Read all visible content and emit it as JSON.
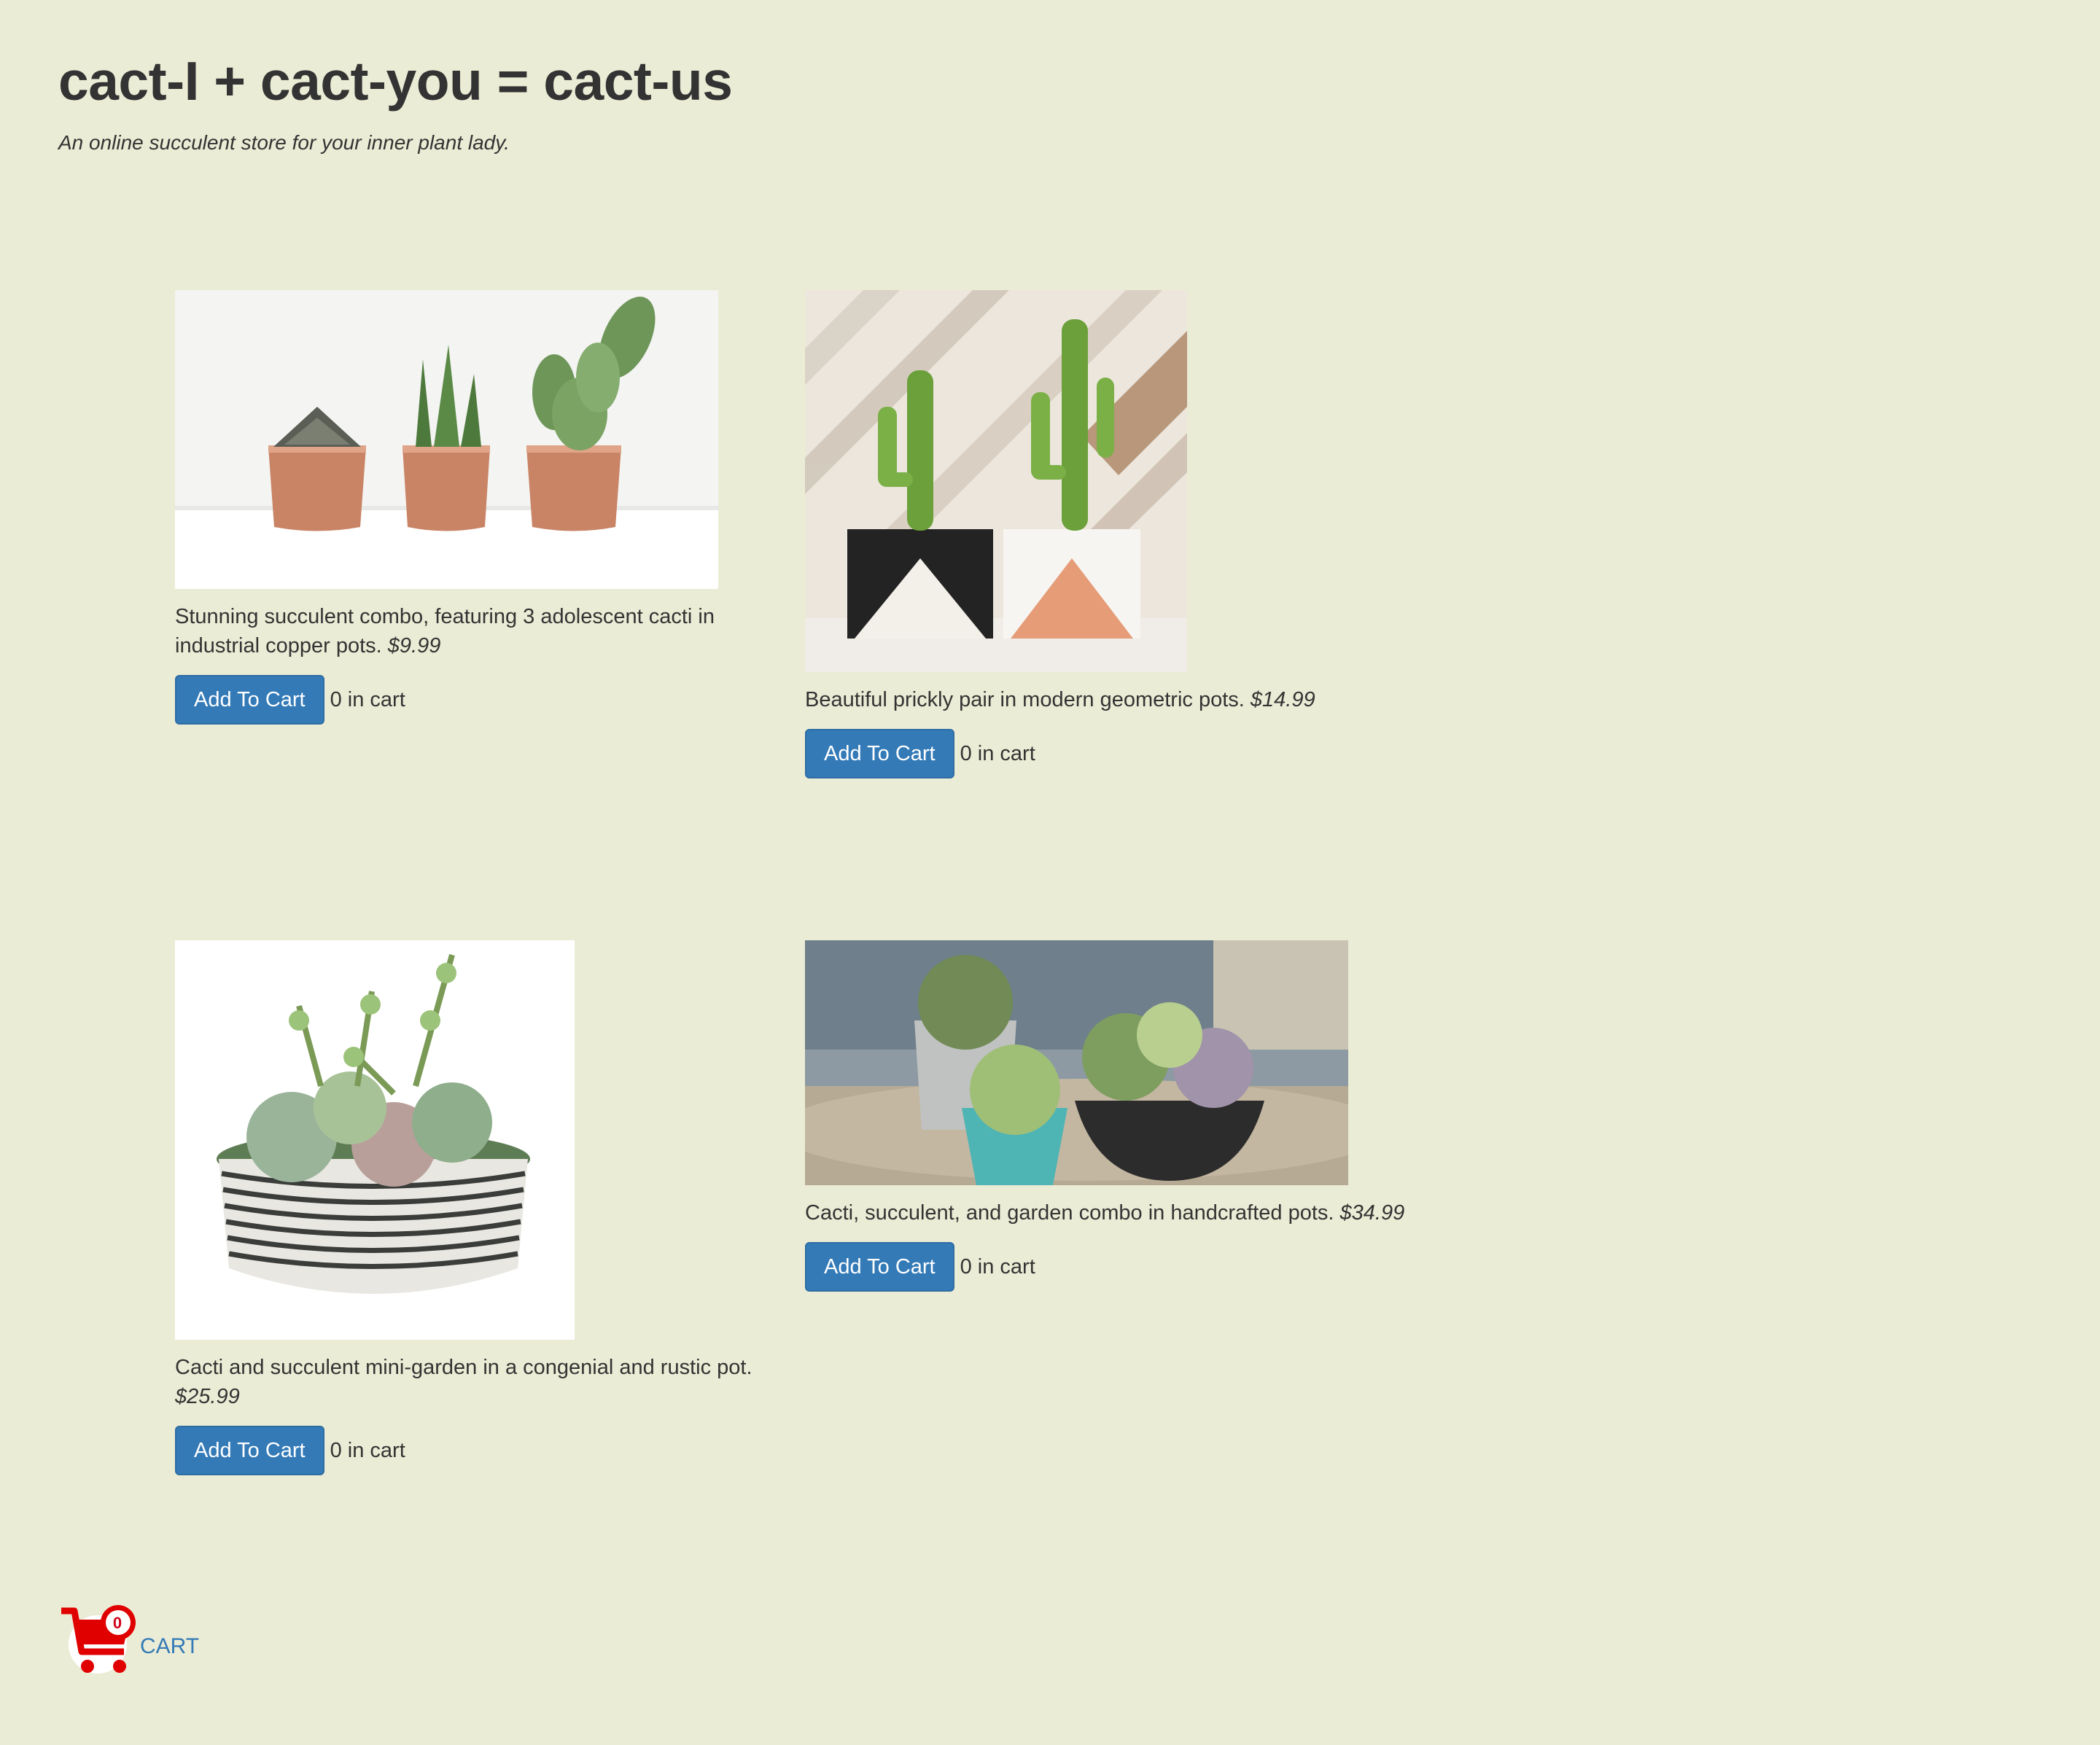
{
  "header": {
    "title": "cact-I + cact-you = cact-us",
    "tagline": "An online succulent store for your inner plant lady."
  },
  "products": [
    {
      "description": "Stunning succulent combo, featuring 3 adolescent cacti in industrial copper pots.",
      "price": "$9.99",
      "button_label": "Add To Cart",
      "cart_status": "0 in cart",
      "image_icon": "three-cacti-copper-pots-photo"
    },
    {
      "description": "Beautiful prickly pair in modern geometric pots.",
      "price": "$14.99",
      "button_label": "Add To Cart",
      "cart_status": "0 in cart",
      "image_icon": "two-cacti-geometric-pots-photo"
    },
    {
      "description": "Cacti and succulent mini-garden in a congenial and rustic pot.",
      "price": "$25.99",
      "button_label": "Add To Cart",
      "cart_status": "0 in cart",
      "image_icon": "succulent-mini-garden-photo"
    },
    {
      "description": "Cacti, succulent, and garden combo in handcrafted pots.",
      "price": "$34.99",
      "button_label": "Add To Cart",
      "cart_status": "0 in cart",
      "image_icon": "garden-combo-handcrafted-pots-photo"
    }
  ],
  "cart": {
    "count": "0",
    "label": "CART",
    "icon": "shopping-cart-icon"
  },
  "colors": {
    "background": "#ebecd5",
    "button": "#337ab7",
    "cart_icon": "#e00000",
    "link": "#337ab7"
  }
}
